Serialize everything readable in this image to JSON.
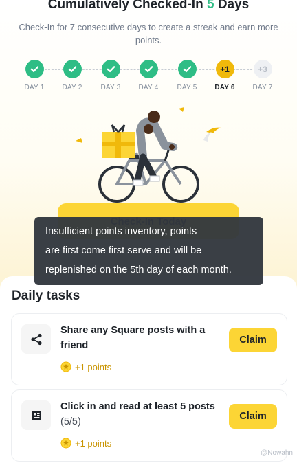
{
  "header": {
    "title_prefix": "Cumulatively Checked-In",
    "title_count": "5",
    "title_suffix": "Days",
    "subtitle": "Check-In for 7 consecutive days to create a streak and earn more points."
  },
  "days": [
    {
      "label": "DAY 1",
      "state": "done"
    },
    {
      "label": "DAY 2",
      "state": "done"
    },
    {
      "label": "DAY 3",
      "state": "done"
    },
    {
      "label": "DAY 4",
      "state": "done"
    },
    {
      "label": "DAY 5",
      "state": "done"
    },
    {
      "label": "DAY 6",
      "state": "today",
      "reward": "+1"
    },
    {
      "label": "DAY 7",
      "state": "future",
      "reward": "+3"
    }
  ],
  "checkin_button": "Check-In Today",
  "tooltip": {
    "line1": "Insufficient points inventory, points",
    "line2": "are first come first serve and will be",
    "line3": "replenished on the 5th day of each month."
  },
  "tasks_section": {
    "title": "Daily tasks",
    "tasks": [
      {
        "icon": "share-icon",
        "title": "Share any Square posts with a friend",
        "progress": "",
        "points": "+1 points",
        "button": "Claim"
      },
      {
        "icon": "article-icon",
        "title": "Click in and read at least 5 posts",
        "progress": "(5/5)",
        "points": "+1 points",
        "button": "Claim"
      }
    ]
  },
  "watermark": "@Nowahn",
  "colors": {
    "done": "#2ebd85",
    "today": "#f0b90b",
    "future": "#eef0f3",
    "button": "#fcd535",
    "points": "#c99400",
    "tooltip_bg": "#32373e"
  }
}
